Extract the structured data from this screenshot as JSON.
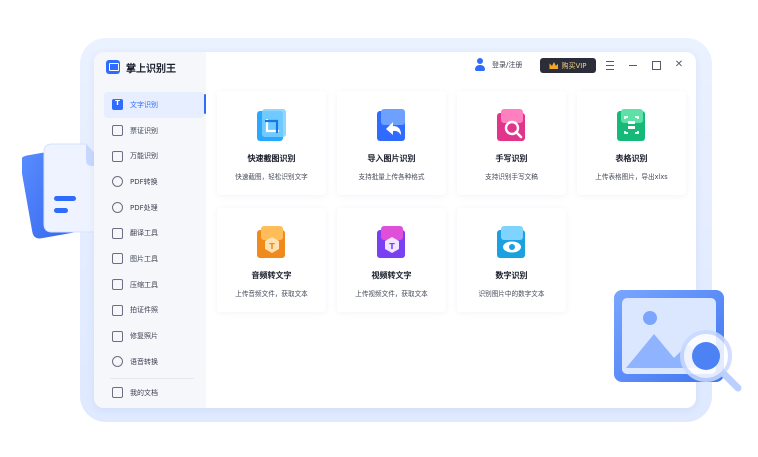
{
  "app": {
    "name": "掌上识别王"
  },
  "topbar": {
    "login_label": "登录/注册",
    "vip_label": "购买VIP",
    "window_controls": [
      "menu-icon",
      "minimize-icon",
      "maximize-icon",
      "close-icon"
    ]
  },
  "sidebar": {
    "items": [
      {
        "label": "文字识别",
        "icon": "text-recognition-icon",
        "active": true
      },
      {
        "label": "票证识别",
        "icon": "ticket-icon",
        "active": false
      },
      {
        "label": "万能识别",
        "icon": "universal-scan-icon",
        "active": false
      },
      {
        "label": "PDF转换",
        "icon": "pdf-convert-icon",
        "active": false
      },
      {
        "label": "PDF处理",
        "icon": "pdf-process-icon",
        "active": false
      },
      {
        "label": "翻译工具",
        "icon": "translate-icon",
        "active": false
      },
      {
        "label": "图片工具",
        "icon": "image-tool-icon",
        "active": false
      },
      {
        "label": "压缩工具",
        "icon": "compress-icon",
        "active": false
      },
      {
        "label": "拍证件照",
        "icon": "id-photo-icon",
        "active": false
      },
      {
        "label": "修复照片",
        "icon": "photo-repair-icon",
        "active": false
      },
      {
        "label": "语音转换",
        "icon": "voice-convert-icon",
        "active": false
      }
    ],
    "docs_label": "我的文档"
  },
  "cards": [
    {
      "title": "快速截图识别",
      "desc": "快速截图，轻松识别文字",
      "icon": "screenshot-icon"
    },
    {
      "title": "导入图片识别",
      "desc": "支持批量上传各种格式",
      "icon": "import-image-icon"
    },
    {
      "title": "手写识别",
      "desc": "支持识别手写文稿",
      "icon": "handwriting-icon"
    },
    {
      "title": "表格识别",
      "desc": "上传表格图片，导出xlxs",
      "icon": "table-icon"
    },
    {
      "title": "音频转文字",
      "desc": "上传音频文件，获取文本",
      "icon": "audio-to-text-icon"
    },
    {
      "title": "视频转文字",
      "desc": "上传视频文件，获取文本",
      "icon": "video-to-text-icon"
    },
    {
      "title": "数字识别",
      "desc": "识别图片中的数字文本",
      "icon": "number-recognition-icon"
    }
  ],
  "colors": {
    "accent": "#2f6bff",
    "sidebar_bg": "#f5f7fb",
    "vip_bg": "#2b2e38",
    "vip_text": "#f5d08a"
  }
}
